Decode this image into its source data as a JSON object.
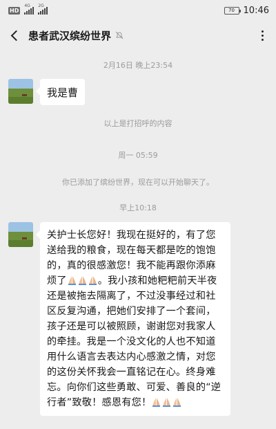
{
  "status_bar": {
    "hd_label": "HD",
    "signal_1_tag": "4G",
    "signal_2_tag": "2G",
    "battery_level": "70",
    "time": "10:46"
  },
  "header": {
    "title": "患者武汉缤纷世界"
  },
  "messages": {
    "ts1": "2月16日 晚上23:54",
    "msg1": "我是曹",
    "note1": "以上是打招呼的内容",
    "ts2": "周一 05:59",
    "note2": "你已添加了缤纷世界，现在可以开始聊天了。",
    "ts3": "早上10:18",
    "msg2_part1": "关护士长您好！我现在挺好的，有了您送给我的粮食，现在每天都是吃的饱饱的，真的很感激您！我不能再跟你添麻烦了",
    "msg2_part2": "。我小孩和她粑粑前天半夜还是被拖去隔离了，不过没事经过和社区反复沟通，把她们安排了一个套间，孩子还是可以被照顾，谢谢您对我家人的牵挂。我是一个没文化的人也不知道用什么语言去表达内心感激之情，对您的这份关怀我会一直铭记在心。终身难忘。向你们这些勇敢、可爱、善良的“逆行者”致敬！感恩有您！"
  },
  "colors": {
    "background": "#ededed",
    "bubble": "#ffffff",
    "system_text": "#9b9b9b"
  },
  "icons": [
    "back-icon",
    "mute-icon",
    "more-icon",
    "pray-emoji-icon"
  ]
}
